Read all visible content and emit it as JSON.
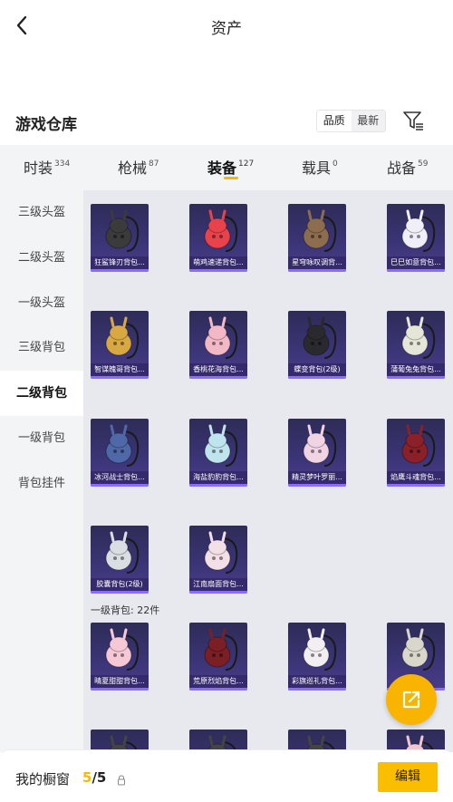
{
  "header": {
    "title": "资产",
    "back_icon": "chevron-left-icon"
  },
  "warehouse": {
    "title": "游戏仓库",
    "sort_options": [
      "品质",
      "最新"
    ],
    "selected_sort": "品质",
    "filter_icon": "filter-list-icon"
  },
  "tabs": [
    {
      "label": "时装",
      "count": "334"
    },
    {
      "label": "枪械",
      "count": "87"
    },
    {
      "label": "装备",
      "count": "127"
    },
    {
      "label": "载具",
      "count": "0"
    },
    {
      "label": "战备",
      "count": "59"
    }
  ],
  "active_tab": "装备",
  "side_menu": [
    {
      "label": "三级头盔"
    },
    {
      "label": "二级头盔"
    },
    {
      "label": "一级头盔"
    },
    {
      "label": "三级背包"
    },
    {
      "label": "二级背包"
    },
    {
      "label": "一级背包"
    },
    {
      "label": "背包挂件"
    }
  ],
  "active_side": "二级背包",
  "items_level2": [
    {
      "name": "狂鲨锋刃背包...",
      "color": "#3b3b3b"
    },
    {
      "name": "萌鸡速递背包...",
      "color": "#e8424b"
    },
    {
      "name": "星穹咏叹调背...",
      "color": "#8c6d4e"
    },
    {
      "name": "巳巳如意背包...",
      "color": "#f0eef6"
    },
    {
      "name": "智谋魄哥背包...",
      "color": "#d8a842"
    },
    {
      "name": "香桃花海背包...",
      "color": "#f2b8c6"
    },
    {
      "name": "蝶变背包(2级)",
      "color": "#2a2a2e"
    },
    {
      "name": "蒲葡兔兔背包...",
      "color": "#e6e6d8"
    },
    {
      "name": "冰河战士背包...",
      "color": "#4e68a8"
    },
    {
      "name": "海盐豹豹背包...",
      "color": "#bfe4ee"
    },
    {
      "name": "精灵梦叶罗丽...",
      "color": "#f1d4e4"
    },
    {
      "name": "焰鹰斗魂背包...",
      "color": "#8a2028"
    },
    {
      "name": "胶囊背包(2级)",
      "color": "#d9dee2"
    },
    {
      "name": "江南扇面背包...",
      "color": "#f3dfe6"
    }
  ],
  "section_level1": "一级背包: 22件",
  "items_level1": [
    {
      "name": "晴夏甜甜背包...",
      "color": "#f6c8d6"
    },
    {
      "name": "荒原烈焰背包...",
      "color": "#7a1f24"
    },
    {
      "name": "彩旗巡礼背包...",
      "color": "#f2eef2"
    },
    {
      "name": "",
      "color": "#d9d6cc"
    },
    {
      "name": "",
      "color": "#444"
    },
    {
      "name": "",
      "color": "#444"
    },
    {
      "name": "",
      "color": "#444"
    },
    {
      "name": "",
      "color": "#f1c6cf"
    }
  ],
  "fab_icon": "share-external-icon",
  "bottom": {
    "label": "我的橱窗",
    "current": "5",
    "separator": "/",
    "total": "5",
    "edit_label": "编辑",
    "lock_icon": "lock-icon"
  },
  "colors": {
    "accent": "#f9b400",
    "card_bg": "#3a3475",
    "card_bar": "#8a6cff"
  }
}
